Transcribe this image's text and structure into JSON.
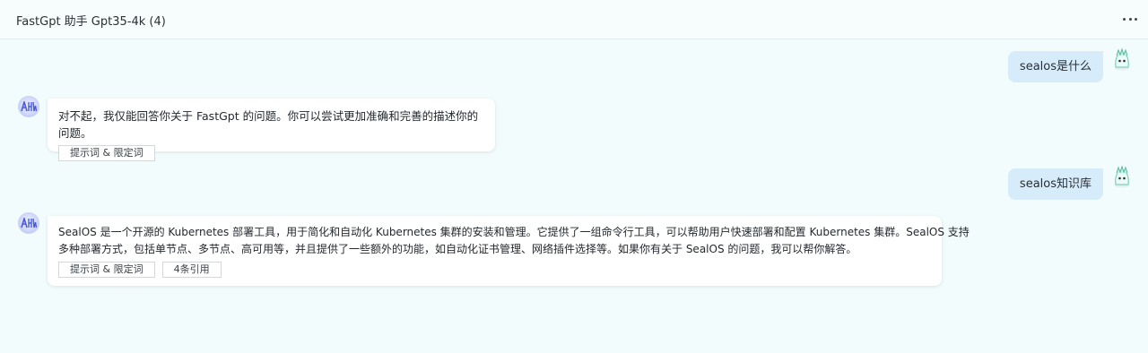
{
  "header": {
    "title": "FastGpt 助手 Gpt35-4k (4)",
    "more_icon": "more-horizontal-icon"
  },
  "messages": [
    {
      "role": "user",
      "text": "sealos是什么",
      "avatar_icon": "user-avatar-icon"
    },
    {
      "role": "assistant",
      "avatar_icon": "bot-avatar-icon",
      "text": "对不起，我仅能回答你关于 FastGpt 的问题。你可以尝试更加准确和完善的描述你的问题。",
      "tags": [
        "提示词 & 限定词"
      ]
    },
    {
      "role": "user",
      "text": "sealos知识库",
      "avatar_icon": "user-avatar-icon"
    },
    {
      "role": "assistant",
      "avatar_icon": "bot-avatar-icon",
      "text_line1": "SealOS 是一个开源的 Kubernetes 部署工具，用于简化和自动化 Kubernetes 集群的安装和管理。它提供了一组命令行工具，可以帮助用户快速部署和配置 Kubernetes 集群。SealOS 支持",
      "text_line2": "多种部署方式，包括单节点、多节点、高可用等，并且提供了一些额外的功能，如自动化证书管理、网络插件选择等。如果你有关于 SealOS 的问题，我可以帮你解答。",
      "tags": [
        "提示词 & 限定词",
        "4条引用"
      ]
    }
  ],
  "colors": {
    "page_background": "#f3fcfc",
    "user_bubble": "#d7ecfb",
    "bot_card": "#ffffff"
  }
}
